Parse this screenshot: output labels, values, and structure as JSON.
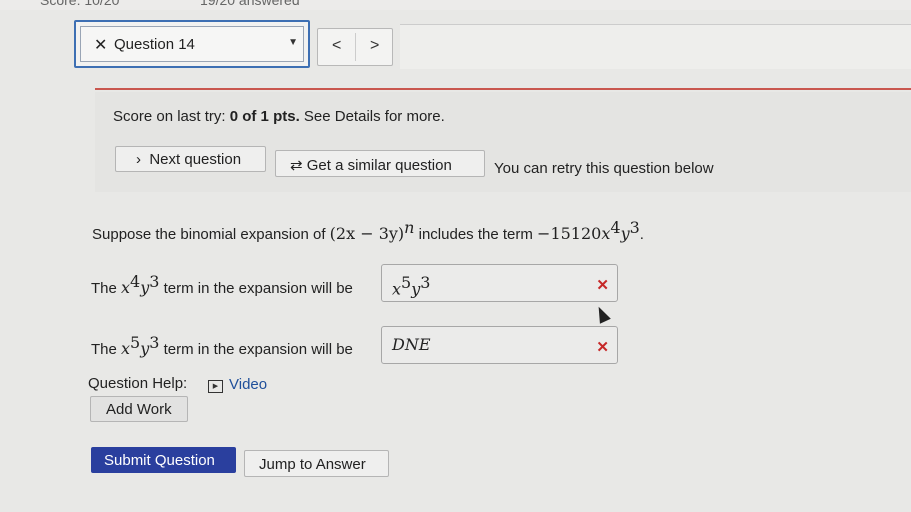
{
  "header": {
    "top_score": "Score: 10/20",
    "top_answered": "19/20 answered",
    "question_select": "Question 14",
    "close_glyph": "✕",
    "prev_glyph": "<",
    "next_glyph": ">"
  },
  "retry_panel": {
    "score_prefix": "Score on last try: ",
    "score_value": "0 of 1 pts.",
    "score_suffix": " See Details for more.",
    "next_question": "Next question",
    "similar_question": "Get a similar question",
    "retry_text": "You can retry this question below"
  },
  "question": {
    "intro": "Suppose the binomial expansion of ",
    "expr_base": "(2x − 3y)",
    "expr_exp": "n",
    "includes": " includes the term ",
    "term_coef": "−15120",
    "term_x": "x",
    "term_x_exp": "4",
    "term_y": "y",
    "term_y_exp": "3",
    "period": "."
  },
  "rows": [
    {
      "prefix": "The ",
      "x_exp": "4",
      "y_exp": "3",
      "suffix": " term in the expansion will be",
      "answer_base_x": "x",
      "answer_x_exp": "5",
      "answer_base_y": "y",
      "answer_y_exp": "3",
      "status_glyph": "✕"
    },
    {
      "prefix": "The ",
      "x_exp": "5",
      "y_exp": "3",
      "suffix": " term in the expansion will be",
      "answer_text": "DNE",
      "status_glyph": "✕"
    }
  ],
  "help": {
    "label": "Question Help:",
    "video": "Video",
    "add_work": "Add Work"
  },
  "actions": {
    "submit": "Submit Question",
    "jump": "Jump to Answer"
  },
  "colors": {
    "accent": "#2a3f9e",
    "error": "#c62828",
    "divider": "#c9574f",
    "link": "#1f4f9a"
  }
}
